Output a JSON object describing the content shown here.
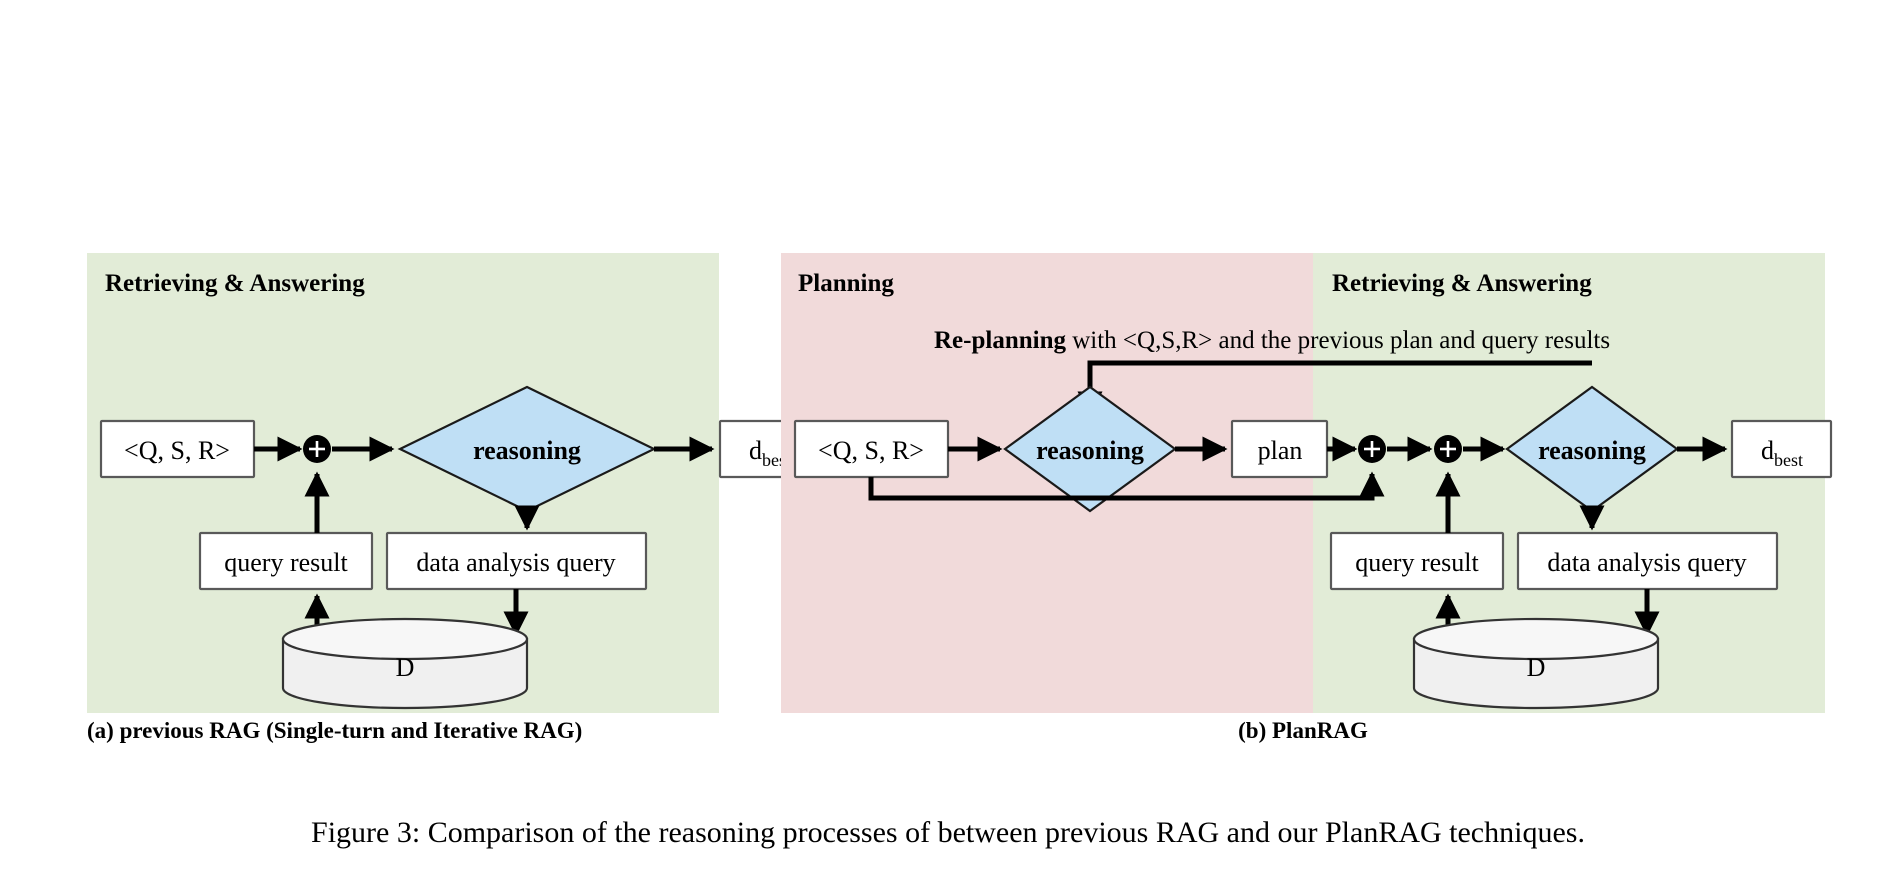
{
  "figure": {
    "caption": "Figure 3: Comparison of the reasoning processes of between previous RAG and our PlanRAG techniques."
  },
  "colors": {
    "green_panel": "#e2ecd7",
    "pink_panel": "#f1dada",
    "diamond_blue": "#bfdff5",
    "cylinder_gray": "#f0f0f0",
    "box_white": "#ffffff",
    "stroke_black": "#000000"
  },
  "panel_a": {
    "sub_caption": "(a) previous RAG (Single-turn and Iterative RAG)",
    "sections": [
      {
        "title": "Retrieving & Answering",
        "fill": "#e2ecd7"
      }
    ],
    "nodes": {
      "input": "<Q, S, R>",
      "merge": "+",
      "reasoning": "reasoning",
      "output": "d",
      "output_sub": "best",
      "query_result": "query result",
      "data_analysis_query": "data analysis query",
      "database": "D"
    }
  },
  "panel_b": {
    "sub_caption": "(b) PlanRAG",
    "sections": [
      {
        "title": "Planning",
        "fill": "#f1dada"
      },
      {
        "title": "Retrieving & Answering",
        "fill": "#e2ecd7"
      }
    ],
    "annotation": {
      "bold": "Re-planning",
      "rest": " with <Q,S,R> and the previous plan and query results"
    },
    "nodes": {
      "input": "<Q, S, R>",
      "reasoning_plan": "reasoning",
      "plan": "plan",
      "merge_1": "+",
      "merge_2": "+",
      "reasoning_answer": "reasoning",
      "output": "d",
      "output_sub": "best",
      "query_result": "query result",
      "data_analysis_query": "data analysis query",
      "database": "D"
    }
  }
}
